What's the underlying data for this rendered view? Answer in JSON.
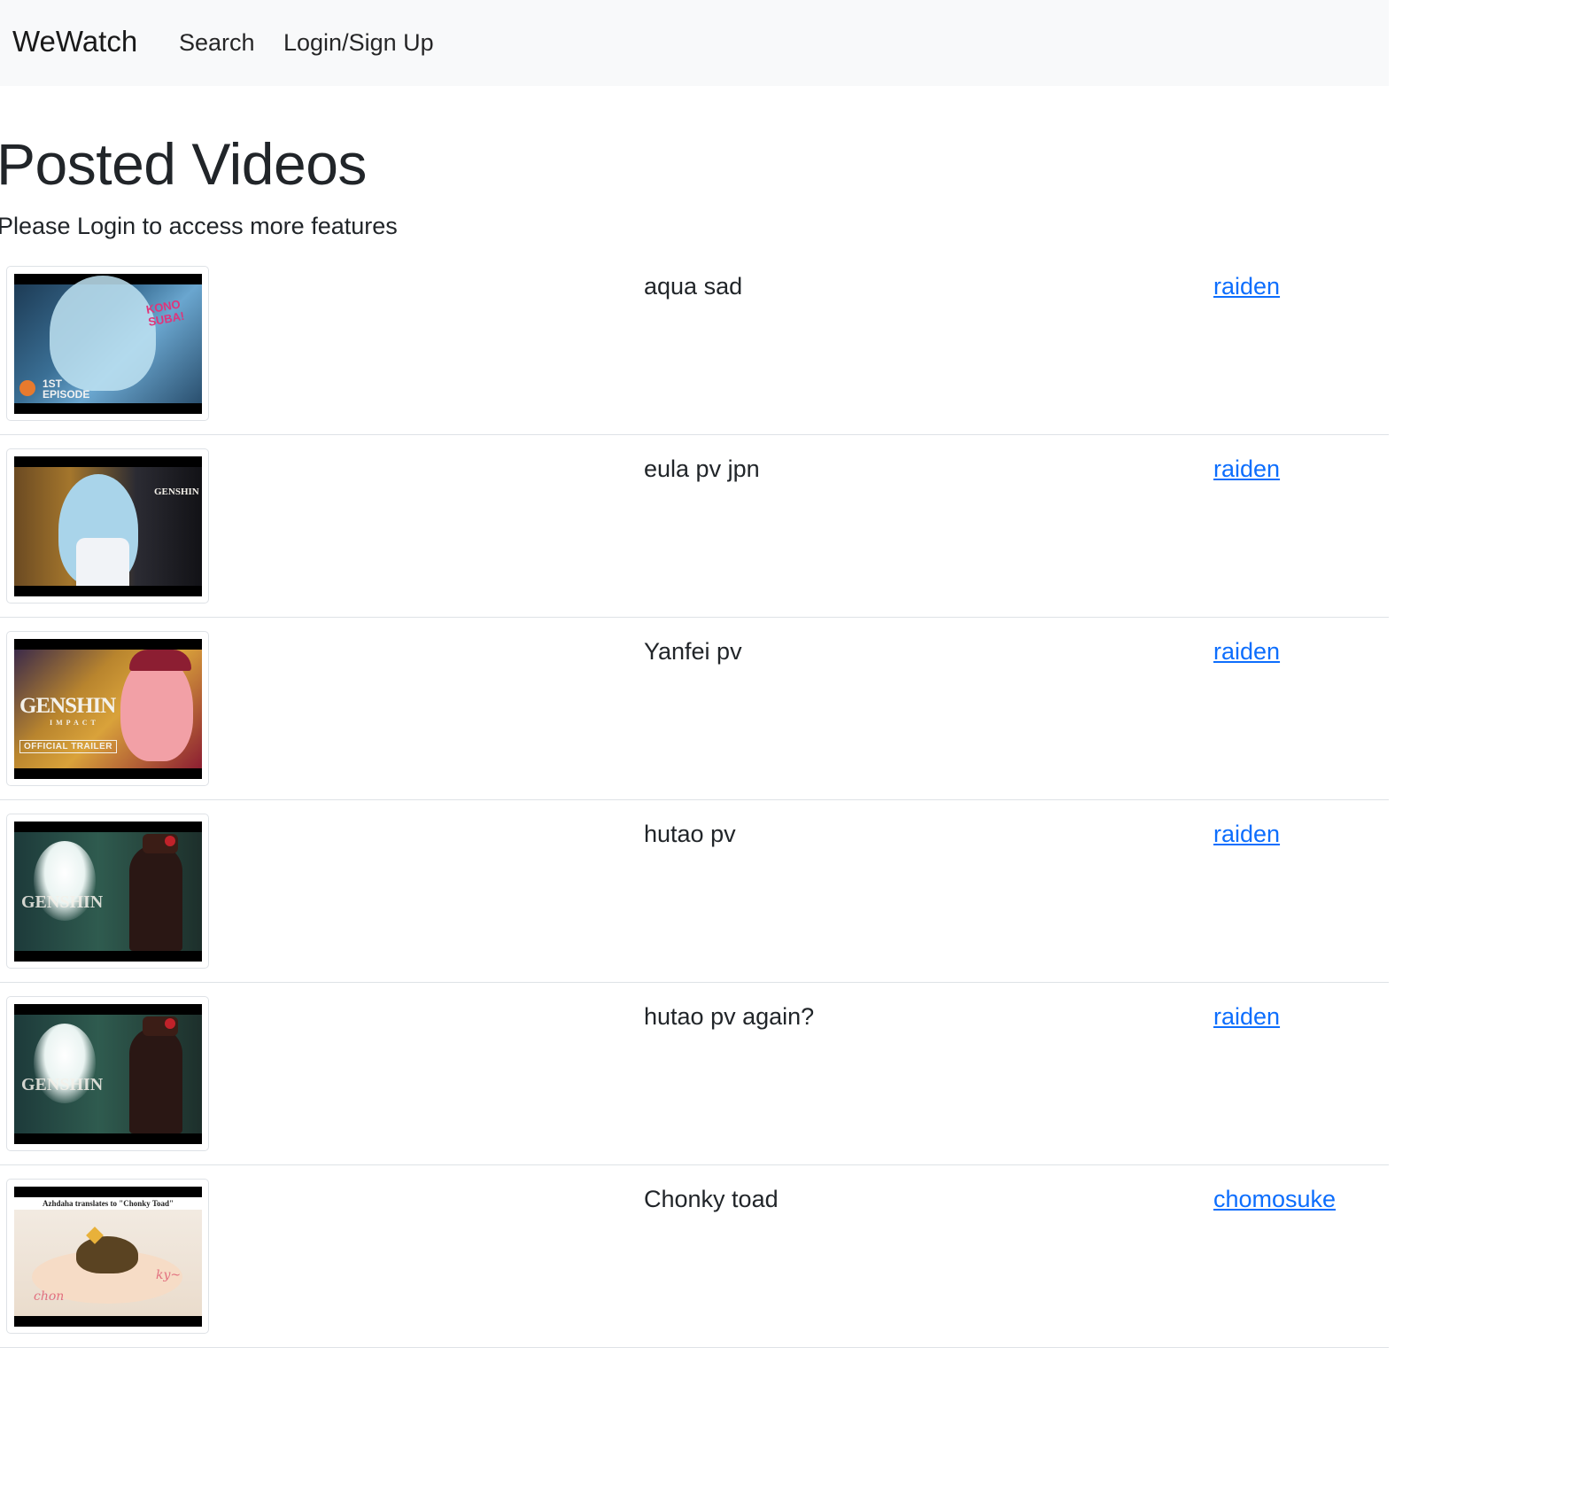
{
  "navbar": {
    "brand": "WeWatch",
    "links": {
      "search": "Search",
      "login": "Login/Sign Up"
    }
  },
  "page": {
    "title": "Posted Videos",
    "subtitle": "Please Login to access more features"
  },
  "videos": [
    {
      "title": "aqua sad",
      "uploader": "raiden",
      "thumbnail": {
        "overlay_lines": [
          "KONO",
          "SUBA!"
        ],
        "badge": "1ST EPISODE"
      }
    },
    {
      "title": "eula pv jpn",
      "uploader": "raiden",
      "thumbnail": {
        "overlay_text": "GENSHIN"
      }
    },
    {
      "title": "Yanfei pv",
      "uploader": "raiden",
      "thumbnail": {
        "overlay_text": "GENSHIN",
        "overlay_subtext": "IMPACT",
        "badge": "OFFICIAL TRAILER"
      }
    },
    {
      "title": "hutao pv",
      "uploader": "raiden",
      "thumbnail": {
        "overlay_text": "GENSHIN"
      }
    },
    {
      "title": "hutao pv again?",
      "uploader": "raiden",
      "thumbnail": {
        "overlay_text": "GENSHIN"
      }
    },
    {
      "title": "Chonky toad",
      "uploader": "chomosuke",
      "thumbnail": {
        "caption": "Azhdaha translates to \"Chonky Toad\"",
        "scribble_left": "chon",
        "scribble_right": "ky~"
      }
    }
  ]
}
